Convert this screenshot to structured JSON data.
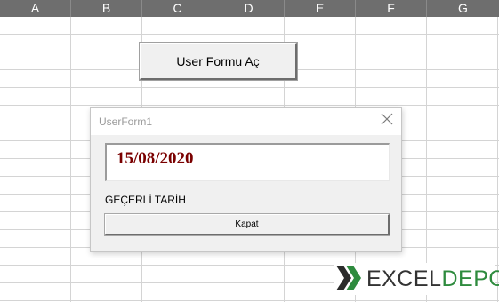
{
  "sheet": {
    "columns": [
      "A",
      "B",
      "C",
      "D",
      "E",
      "F",
      "G"
    ],
    "button_label": "User Formu Aç"
  },
  "userform": {
    "title": "UserForm1",
    "date_value": "15/08/2020",
    "label": "GEÇERLİ TARİH",
    "close_button_label": "Kapat",
    "date_color": "#7a0000"
  },
  "logo": {
    "text_part1": "EXCEL",
    "text_part2": "DEPO",
    "colors": {
      "dark": "#333333",
      "green": "#2e8b3e"
    }
  }
}
